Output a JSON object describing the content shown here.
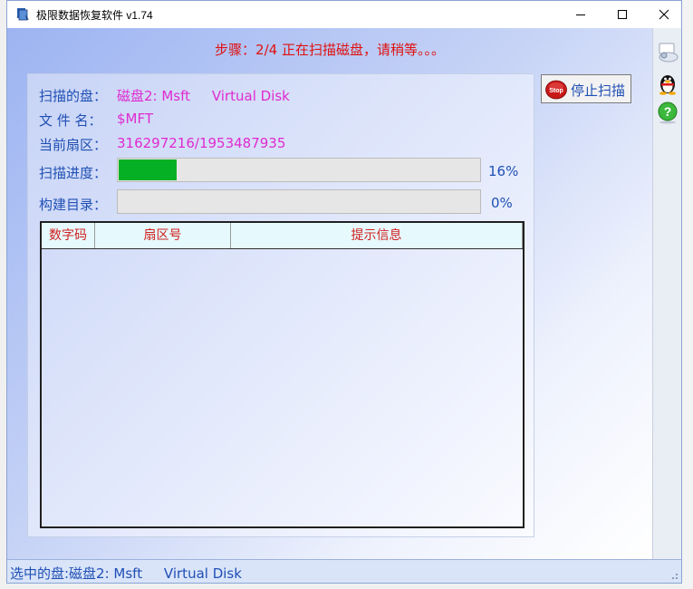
{
  "window": {
    "title": "极限数据恢复软件 v1.74"
  },
  "step_text": "步骤：2/4 正在扫描磁盘，请稍等。。。",
  "scan_info": {
    "disk_label": "扫描的盘：",
    "disk_value": "磁盘2: Msft     Virtual Disk",
    "file_label": "文 件 名：",
    "file_value": "$MFT",
    "sector_label": "当前扇区：",
    "sector_value": "316297216/1953487935",
    "progress_label": "扫描进度：",
    "progress_percent_text": "16%",
    "progress_value": 0.16,
    "build_label": "构建目录：",
    "build_percent_text": "0%",
    "build_value": 0
  },
  "table": {
    "columns": [
      "数字码",
      "扇区号",
      "提示信息"
    ],
    "rows": []
  },
  "stop_button": {
    "label": "停止扫描",
    "icon": "stop-sign-icon"
  },
  "side_toolbar": {
    "icons": [
      "settings-cloud-icon",
      "qq-penguin-icon",
      "help-icon"
    ]
  },
  "status": {
    "text": "选中的盘:磁盘2: Msft     Virtual Disk"
  },
  "colors": {
    "label_blue": "#1f4fb4",
    "value_magenta": "#e02ad0",
    "title_red": "#e01010",
    "progress_green": "#06b025"
  }
}
